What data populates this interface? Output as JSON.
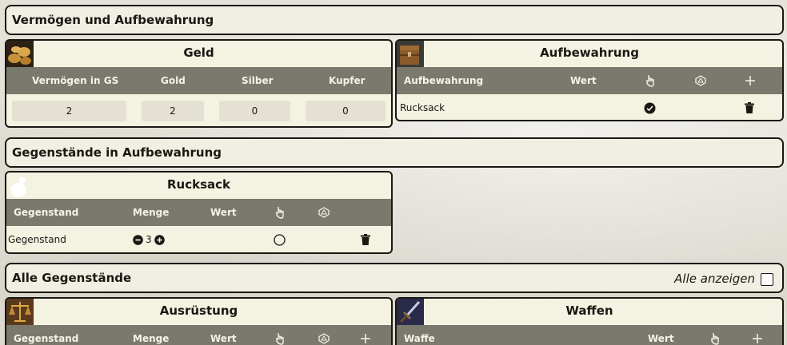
{
  "section_wealth": {
    "title": "Vermögen und Aufbewahrung"
  },
  "money": {
    "title": "Geld",
    "columns": [
      "Vermögen in GS",
      "Gold",
      "Silber",
      "Kupfer"
    ],
    "values": [
      "2",
      "2",
      "0",
      "0"
    ]
  },
  "storage": {
    "title": "Aufbewahrung",
    "columns": [
      "Aufbewahrung",
      "Wert"
    ],
    "rows": [
      {
        "name": "Rucksack",
        "equipped": true
      }
    ]
  },
  "section_stored": {
    "title": "Gegenstände in Aufbewahrung"
  },
  "backpack": {
    "title": "Rucksack",
    "columns": [
      "Gegenstand",
      "Menge",
      "Wert"
    ],
    "rows": [
      {
        "name": "Gegenstand",
        "quantity": "3",
        "equipped": false
      }
    ]
  },
  "section_all": {
    "title": "Alle Gegenstände",
    "show_all_label": "Alle anzeigen",
    "show_all_checked": false
  },
  "equipment": {
    "title": "Ausrüstung",
    "columns": [
      "Gegenstand",
      "Menge",
      "Wert"
    ]
  },
  "weapons": {
    "title": "Waffen",
    "columns": [
      "Waffe",
      "Wert"
    ]
  },
  "icons": {
    "equip_col": "hand-pointer-icon",
    "magic_col": "dice-icon",
    "add_col": "plus-icon",
    "equipped": "check-circle-icon",
    "unequipped": "empty-circle-icon",
    "delete": "trash-icon",
    "decrease": "minus-circle-icon",
    "increase": "plus-circle-icon"
  },
  "colors": {
    "header_bg": "#7a796d",
    "panel_bg": "#f4f2e0",
    "border": "#191813"
  }
}
